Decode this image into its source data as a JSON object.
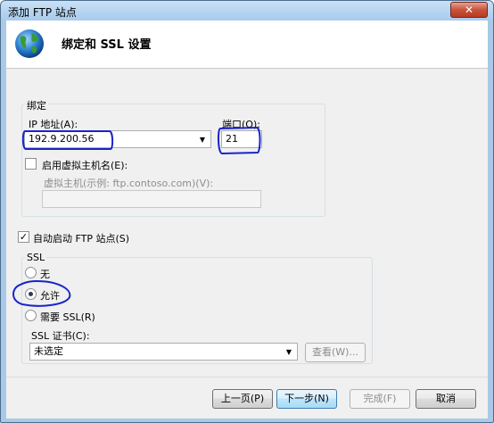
{
  "window": {
    "title": "添加 FTP 站点",
    "close_glyph": "✕"
  },
  "header": {
    "title": "绑定和 SSL 设置"
  },
  "binding": {
    "group_label": "绑定",
    "ip_label": "IP 地址(A):",
    "ip_value": "192.9.200.56",
    "port_label": "端口(O):",
    "port_value": "21",
    "virtual_host_checkbox_label": "启用虚拟主机名(E):",
    "virtual_host_checked": false,
    "virtual_host_label": "虚拟主机(示例: ftp.contoso.com)(V):",
    "virtual_host_value": ""
  },
  "auto_start": {
    "label": "自动启动 FTP 站点(S)",
    "checked": true
  },
  "ssl": {
    "group_label": "SSL",
    "options": [
      {
        "label": "无",
        "selected": false
      },
      {
        "label": "允许",
        "selected": true
      },
      {
        "label": "需要 SSL(R)",
        "selected": false
      }
    ],
    "cert_label": "SSL 证书(C):",
    "cert_value": "未选定",
    "view_button": "查看(W)..."
  },
  "footer": {
    "prev": "上一页(P)",
    "next": "下一步(N)",
    "finish": "完成(F)",
    "cancel": "取消"
  },
  "colors": {
    "annotation_ink": "#1a24c8",
    "title_bar": "#a8cbeb"
  },
  "icons": {
    "site_icon": "globe-icon",
    "dropdown": "chevron-down-icon"
  }
}
